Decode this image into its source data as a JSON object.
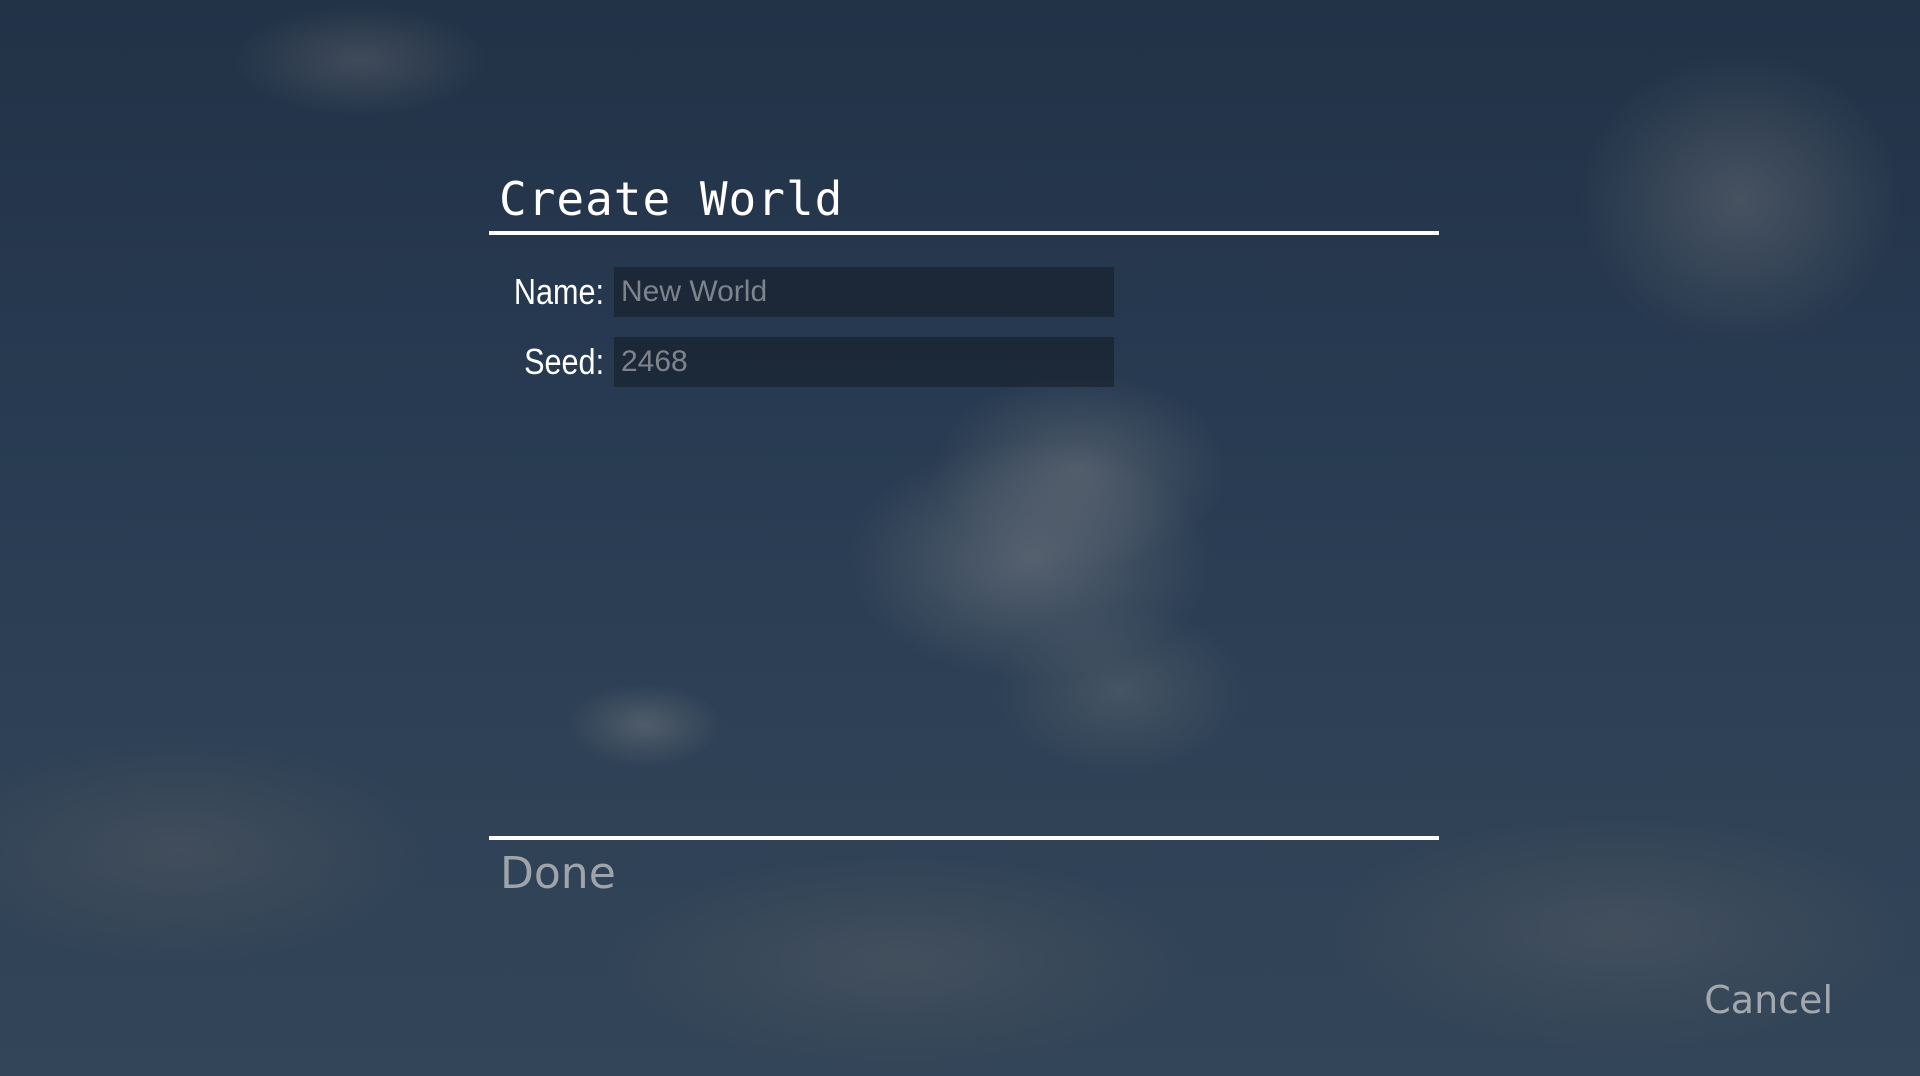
{
  "screen": {
    "title": "Create World",
    "background": "sky-with-clouds"
  },
  "form": {
    "name": {
      "label": "Name:",
      "value": "",
      "placeholder": "New World"
    },
    "seed": {
      "label": "Seed:",
      "value": "",
      "placeholder": "2468"
    }
  },
  "actions": {
    "done_label": "Done",
    "cancel_label": "Cancel"
  },
  "colors": {
    "divider": "#ffffff",
    "title_text": "#ffffff",
    "button_text": "#9ea4aa",
    "input_background": "#161e2a",
    "placeholder_text": "#7d848c"
  }
}
